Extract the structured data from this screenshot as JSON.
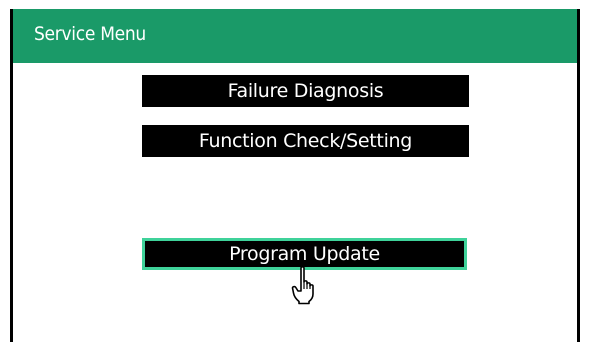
{
  "header": {
    "title": "Service Menu"
  },
  "menu": {
    "items": [
      {
        "label": "Failure Diagnosis"
      },
      {
        "label": "Function Check/Setting"
      },
      {
        "label": "Program Update"
      }
    ]
  },
  "colors": {
    "header_bg": "#1a9a68",
    "button_bg": "#000000",
    "button_text": "#ffffff",
    "selected_outline": "#3fd29a"
  },
  "cursor": {
    "icon": "pointing-hand-icon"
  }
}
